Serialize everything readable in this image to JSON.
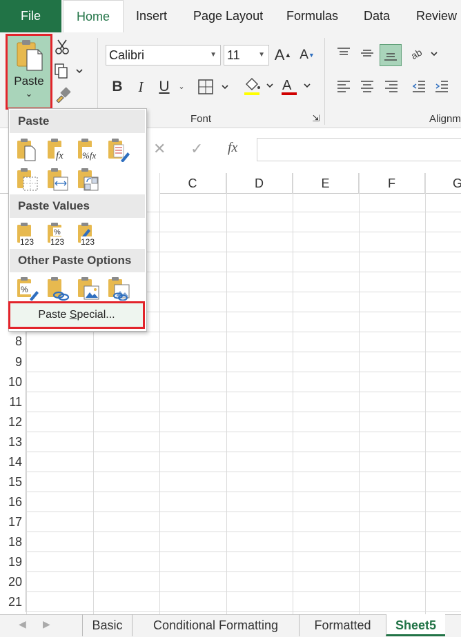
{
  "ribbon_tabs": [
    "File",
    "Home",
    "Insert",
    "Page Layout",
    "Formulas",
    "Data",
    "Review"
  ],
  "clipboard": {
    "paste_label": "Paste"
  },
  "font": {
    "name": "Calibri",
    "size": "11",
    "group_label": "Font",
    "bold": "B",
    "italic": "I",
    "underline": "U"
  },
  "alignment": {
    "group_label": "Alignm"
  },
  "formula_bar": {
    "fx": "fx",
    "value": ""
  },
  "columns": [
    "C",
    "D",
    "E",
    "F",
    "G"
  ],
  "rows": [
    "8",
    "9",
    "10",
    "11",
    "12",
    "13",
    "14",
    "15",
    "16",
    "17",
    "18",
    "19",
    "20",
    "21"
  ],
  "paste_menu": {
    "section_paste": "Paste",
    "section_values": "Paste Values",
    "section_other": "Other Paste Options",
    "special_prefix": "Paste ",
    "special_underlined": "S",
    "special_suffix": "pecial...",
    "paste_icons": [
      "paste-icon",
      "paste-formulas-icon",
      "paste-formulas-number-formatting-icon",
      "keep-source-formatting-icon",
      "no-borders-icon",
      "keep-column-widths-icon",
      "transpose-icon"
    ],
    "values_icons": [
      "paste-values-icon",
      "values-number-formatting-icon",
      "values-source-formatting-icon"
    ],
    "other_icons": [
      "paste-formatting-icon",
      "paste-link-icon",
      "paste-picture-icon",
      "linked-picture-icon"
    ],
    "icon_badges": {
      "fx": "fx",
      "pct_fx": "%fx",
      "num": "123",
      "pct": "%"
    }
  },
  "sheet_tabs": [
    "Basic",
    "Conditional Formatting",
    "Formatted",
    "Sheet5"
  ],
  "active_sheet": "Sheet5",
  "colors": {
    "excel_green": "#217346",
    "highlight_red": "#e2242b",
    "paste_bg": "#a9d4ba",
    "clipboard_tan": "#e7b94f"
  }
}
